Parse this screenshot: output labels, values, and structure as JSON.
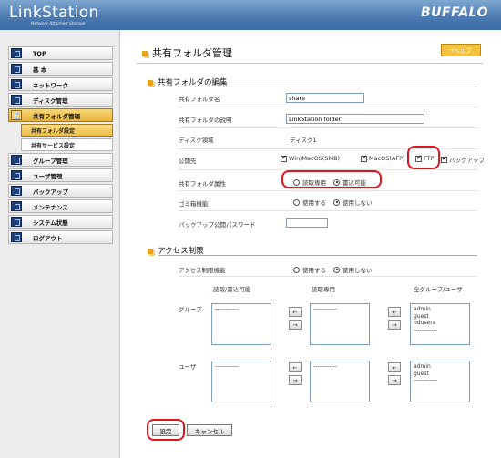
{
  "header": {
    "logo": "LinkStation",
    "tagline": "Network Attached Storage",
    "brand": "BUFFALO"
  },
  "sidebar": {
    "items": [
      {
        "label": "TOP",
        "icon": "top-icon"
      },
      {
        "label": "基 本",
        "icon": "basic-icon"
      },
      {
        "label": "ネットワーク",
        "icon": "network-icon"
      },
      {
        "label": "ディスク管理",
        "icon": "disk-icon"
      },
      {
        "label": "共有フォルダ管理",
        "icon": "folder-icon",
        "active": true
      },
      {
        "label": "グループ管理",
        "icon": "group-icon"
      },
      {
        "label": "ユーザ管理",
        "icon": "user-icon"
      },
      {
        "label": "バックアップ",
        "icon": "backup-icon"
      },
      {
        "label": "メンテナンス",
        "icon": "maintenance-icon"
      },
      {
        "label": "システム状態",
        "icon": "system-icon"
      },
      {
        "label": "ログアウト",
        "icon": "logout-icon"
      }
    ],
    "subitems": [
      {
        "label": "共有フォルダ設定",
        "active": true
      },
      {
        "label": "共有サービス設定"
      }
    ]
  },
  "main": {
    "title": "共有フォルダ管理",
    "help": "?ヘルプ",
    "edit_section": "共有フォルダの編集",
    "fields": {
      "name_label": "共有フォルダ名",
      "name_value": "share",
      "desc_label": "共有フォルダの説明",
      "desc_value": "LinkStation folder",
      "disk_label": "ディスク領域",
      "disk_value": "ディスク1",
      "publish_label": "公開先",
      "publish_opts": [
        "Win/MacOS(SMB)",
        "MacOS(AFP)",
        "FTP",
        "バックアップ"
      ],
      "attr_label": "共有フォルダ属性",
      "attr_opts": [
        "読取専用",
        "書込可能"
      ],
      "trash_label": "ゴミ箱機能",
      "trash_opts": [
        "使用する",
        "使用しない"
      ],
      "backup_pw_label": "バックアップ公開パスワード",
      "backup_pw_value": ""
    },
    "access_section": "アクセス制限",
    "access": {
      "label": "アクセス制限機能",
      "opts": [
        "使用する",
        "使用しない"
      ],
      "col_rw": "読取/書込可能",
      "col_ro": "読取専用",
      "col_all": "全グループ/ユーザ",
      "group_label": "グループ",
      "user_label": "ユーザ",
      "group_rw": [
        "------------"
      ],
      "group_ro": [
        "------------"
      ],
      "group_all": [
        "admin",
        "guest",
        "hdusers",
        "------------"
      ],
      "user_rw": [
        "------------"
      ],
      "user_ro": [
        "------------"
      ],
      "user_all": [
        "admin",
        "guest",
        "------------"
      ],
      "arrow_left": "←",
      "arrow_right": "→"
    },
    "buttons": {
      "submit": "設定",
      "cancel": "キャンセル"
    }
  }
}
